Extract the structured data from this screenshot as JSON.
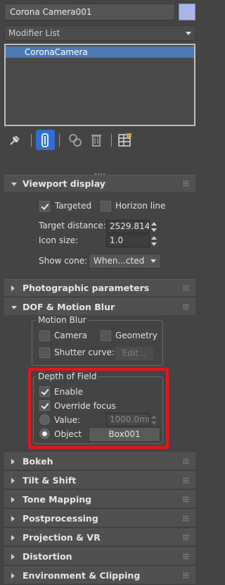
{
  "object_name": "Corona Camera001",
  "object_color": "#a7b6e6",
  "modifier_list": {
    "label": "Modifier List"
  },
  "modifier_stack": {
    "items": [
      "CoronaCamera"
    ],
    "selected_index": 0
  },
  "stack_toolbar": {
    "icons": [
      "pin-stack-icon",
      "show-end-result-icon",
      "make-unique-icon",
      "remove-modifier-icon",
      "configure-modifier-sets-icon"
    ]
  },
  "viewport_display": {
    "title": "Viewport display",
    "targeted": {
      "label": "Targeted",
      "checked": true
    },
    "horizon_line": {
      "label": "Horizon line",
      "checked": false
    },
    "target_distance": {
      "label": "Target distance:",
      "value": "2529.814"
    },
    "icon_size": {
      "label": "Icon size:",
      "value": "1.0"
    },
    "show_cone": {
      "label": "Show cone:",
      "value": "When...cted"
    }
  },
  "photographic_parameters": {
    "title": "Photographic parameters"
  },
  "dof_motion_blur": {
    "title": "DOF & Motion Blur",
    "motion_blur": {
      "title": "Motion Blur",
      "camera": {
        "label": "Camera",
        "checked": false
      },
      "geometry": {
        "label": "Geometry",
        "checked": false
      },
      "shutter_curve": {
        "label": "Shutter curve:",
        "checked": false
      },
      "edit_button": "Edit..."
    },
    "depth_of_field": {
      "title": "Depth of Field",
      "enable": {
        "label": "Enable",
        "checked": true
      },
      "override_focus": {
        "label": "Override focus",
        "checked": true
      },
      "value": {
        "label": "Value:",
        "value": "1000.0mr",
        "selected": false
      },
      "object": {
        "label": "Object",
        "value": "Box001",
        "selected": true
      }
    }
  },
  "collapsed_rollouts": [
    "Bokeh",
    "Tilt & Shift",
    "Tone Mapping",
    "Postprocessing",
    "Projection & VR",
    "Distortion",
    "Environment & Clipping"
  ],
  "colors": {
    "panel_bg": "#444444",
    "selection": "#4b7ab4",
    "active_tool": "#2f6fd0",
    "highlight": "#e3161b"
  }
}
